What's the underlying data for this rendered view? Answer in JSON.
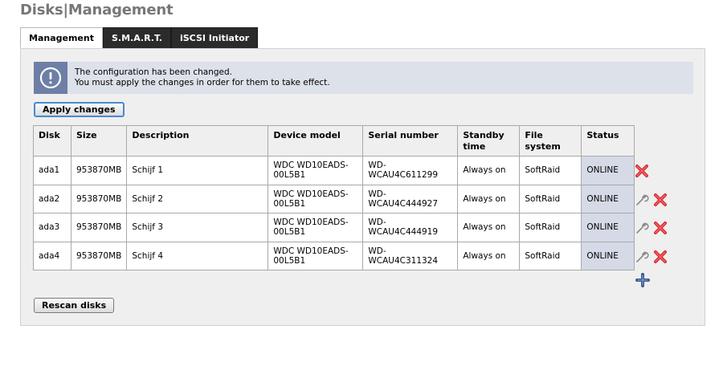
{
  "page": {
    "title": "Disks|Management"
  },
  "tabs": [
    {
      "label": "Management",
      "active": true
    },
    {
      "label": "S.M.A.R.T.",
      "active": false
    },
    {
      "label": "iSCSI Initiator",
      "active": false
    }
  ],
  "notice": {
    "icon": "exclamation-icon",
    "line1": "The configuration has been changed.",
    "line2": "You must apply the changes in order for them to take effect."
  },
  "buttons": {
    "apply": "Apply changes",
    "rescan": "Rescan disks"
  },
  "table": {
    "headers": {
      "disk": "Disk",
      "size": "Size",
      "description": "Description",
      "device_model": "Device model",
      "serial": "Serial number",
      "standby_1": "Standby",
      "standby_2": "time",
      "fs_1": "File",
      "fs_2": "system",
      "status": "Status"
    },
    "rows": [
      {
        "disk": "ada1",
        "size": "953870MB",
        "description": "Schijf 1",
        "model_1": "WDC WD10EADS-",
        "model_2": "00L5B1",
        "serial": "WD-WCAU4C611299",
        "standby": "Always on",
        "fs": "SoftRaid",
        "status": "ONLINE",
        "edit": false
      },
      {
        "disk": "ada2",
        "size": "953870MB",
        "description": "Schijf 2",
        "model_1": "WDC WD10EADS-",
        "model_2": "00L5B1",
        "serial": "WD-WCAU4C444927",
        "standby": "Always on",
        "fs": "SoftRaid",
        "status": "ONLINE",
        "edit": true
      },
      {
        "disk": "ada3",
        "size": "953870MB",
        "description": "Schijf 3",
        "model_1": "WDC WD10EADS-",
        "model_2": "00L5B1",
        "serial": "WD-WCAU4C444919",
        "standby": "Always on",
        "fs": "SoftRaid",
        "status": "ONLINE",
        "edit": true
      },
      {
        "disk": "ada4",
        "size": "953870MB",
        "description": "Schijf 4",
        "model_1": "WDC WD10EADS-",
        "model_2": "00L5B1",
        "serial": "WD-WCAU4C311324",
        "standby": "Always on",
        "fs": "SoftRaid",
        "status": "ONLINE",
        "edit": true
      }
    ]
  },
  "icons": {
    "edit": "wrench-icon",
    "delete": "delete-x-icon",
    "add": "plus-icon"
  },
  "colors": {
    "notice_bg": "#dde1ea",
    "notice_icon_bg": "#6d7fa6",
    "status_bg": "#d5dae6",
    "delete_red": "#d8262d",
    "add_blue": "#3a5a8c"
  }
}
